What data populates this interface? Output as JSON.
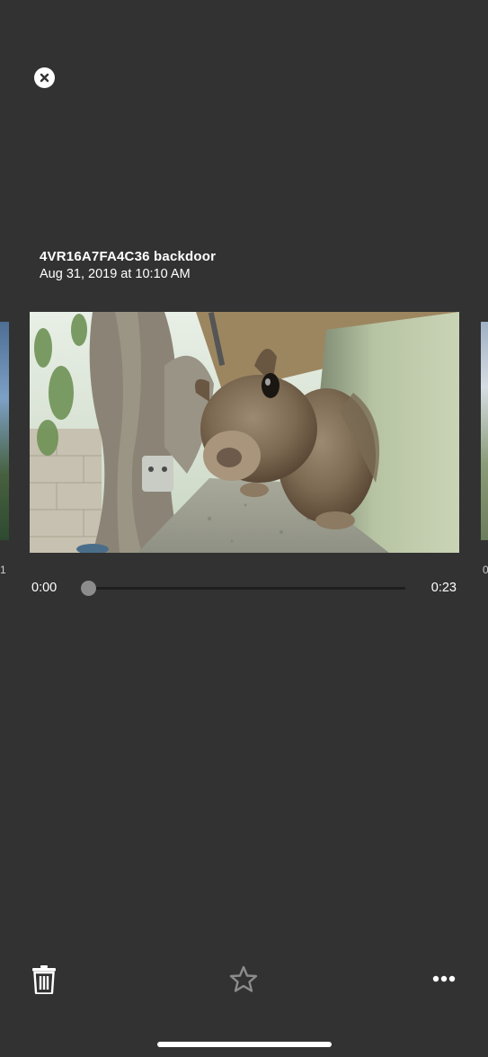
{
  "header": {
    "close_icon": "close-circle-icon"
  },
  "clip": {
    "title": "4VR16A7FA4C36 backdoor",
    "date": "Aug 31, 2019 at 10:10 AM"
  },
  "player": {
    "time_current": "0:00",
    "time_total": "0:23",
    "progress": 0.0
  },
  "carousel": {
    "prev_label_fragment": "1",
    "next_label_fragment": "0"
  },
  "toolbar": {
    "delete_icon": "trash-icon",
    "favorite_icon": "star-icon",
    "more_icon": "more-icon"
  },
  "colors": {
    "background": "#323232",
    "foreground": "#ffffff",
    "scrubber_thumb": "#8c8c8c",
    "icon_inactive": "#8c8c8c"
  }
}
